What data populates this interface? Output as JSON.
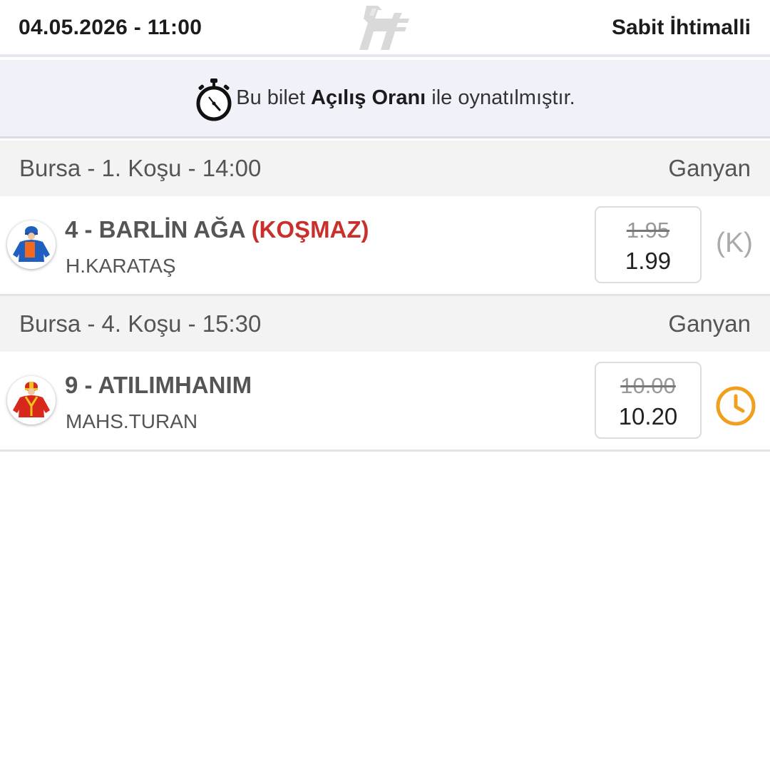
{
  "header": {
    "datetime": "04.05.2026 - 11:00",
    "logo_icon": "horse-racing-logo-icon",
    "bet_type": "Sabit İhtimalli"
  },
  "notice": {
    "icon": "stopwatch-icon",
    "text_before": "Bu bilet ",
    "text_bold": "Açılış Oranı",
    "text_after": " ile oynatılmıştır."
  },
  "races": [
    {
      "title": "Bursa - 1. Koşu - 14:00",
      "type": "Ganyan",
      "runner": {
        "name": "4 - BARLİN AĞA",
        "scratch_label": "(KOŞMAZ)",
        "jockey": "H.KARATAŞ",
        "silk_icon": "jockey-silk-blue-orange-icon",
        "old_odds": "1.95",
        "new_odds": "1.99",
        "status": "(K)"
      }
    },
    {
      "title": "Bursa - 4. Koşu - 15:30",
      "type": "Ganyan",
      "runner": {
        "name": "9 - ATILIMHANIM",
        "jockey": "MAHS.TURAN",
        "silk_icon": "jockey-silk-red-yellow-icon",
        "old_odds": "10.00",
        "new_odds": "10.20",
        "status_icon": "clock-icon",
        "status_color": "#f0a01e"
      }
    }
  ],
  "colors": {
    "scratched": "#c9302c",
    "pending_clock": "#f0a01e",
    "notice_bg": "#f1f2f9",
    "race_header_bg": "#f3f3f4"
  }
}
